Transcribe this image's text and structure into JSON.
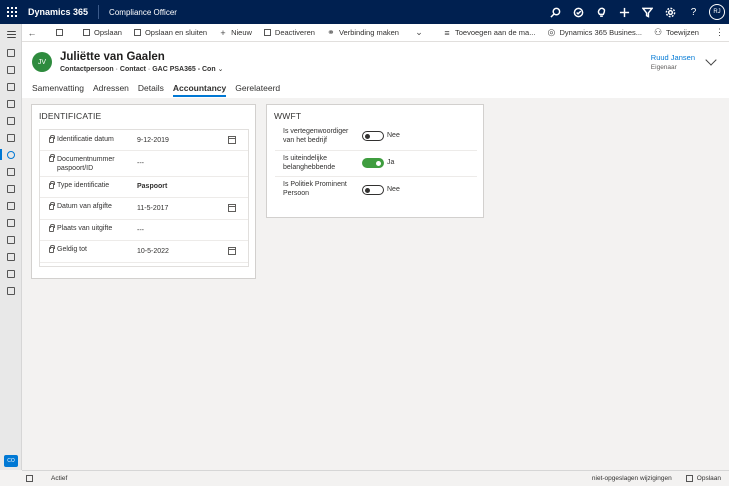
{
  "app": {
    "brand": "Dynamics 365",
    "app_name": "Compliance Officer",
    "user_initials": "RJ",
    "top_icons": [
      "search-icon",
      "task-icon",
      "lightbulb-icon",
      "plus-icon",
      "filter-icon",
      "gear-icon",
      "help-icon"
    ]
  },
  "nav": {
    "area_badge": "CO",
    "items": [
      "home-icon",
      "recent-icon",
      "pinned-icon",
      "dashboard-icon",
      "calendar-icon",
      "accounts-icon",
      "contacts-icon",
      "documents-icon",
      "links-icon",
      "reports-icon",
      "location-icon",
      "chart-icon",
      "list-icon",
      "relations-icon",
      "sync-icon"
    ]
  },
  "commands": {
    "save": "Opslaan",
    "save_close": "Opslaan en sluiten",
    "new": "Nieuw",
    "deactivate": "Deactiveren",
    "connect": "Verbinding maken",
    "add_to": "Toevoegen aan de ma...",
    "business": "Dynamics 365 Busines...",
    "assign": "Toewijzen"
  },
  "record": {
    "initials": "JV",
    "name": "Juliëtte van Gaalen",
    "type": "Contactpersoon",
    "entity": "Contact",
    "form": "GAC PSA365 - Con",
    "owner_name": "Ruud Jansen",
    "owner_label": "Eigenaar"
  },
  "tabs": [
    "Samenvatting",
    "Adressen",
    "Details",
    "Accountancy",
    "Gerelateerd"
  ],
  "identificatie": {
    "title": "IDENTIFICATIE",
    "fields": [
      {
        "label": "Identificatie datum",
        "value": "9-12-2019"
      },
      {
        "label": "Documentnummer paspoort/ID",
        "value": "---"
      },
      {
        "label": "Type identificatie",
        "value": "Paspoort"
      },
      {
        "label": "Datum van afgifte",
        "value": "11-5-2017"
      },
      {
        "label": "Plaats van uitgifte",
        "value": "---"
      },
      {
        "label": "Geldig tot",
        "value": "10-5-2022"
      }
    ]
  },
  "wwft": {
    "title": "WWFT",
    "fields": [
      {
        "label": "Is vertegenwoordiger van het bedrijf",
        "value": "Nee",
        "on": false
      },
      {
        "label": "Is uiteindelijke belanghebbende",
        "value": "Ja",
        "on": true
      },
      {
        "label": "Is Politiek Prominent Persoon",
        "value": "Nee",
        "on": false
      }
    ]
  },
  "status": {
    "state": "Actief",
    "unsaved": "niet-opgeslagen wijzigingen",
    "save": "Opslaan"
  }
}
